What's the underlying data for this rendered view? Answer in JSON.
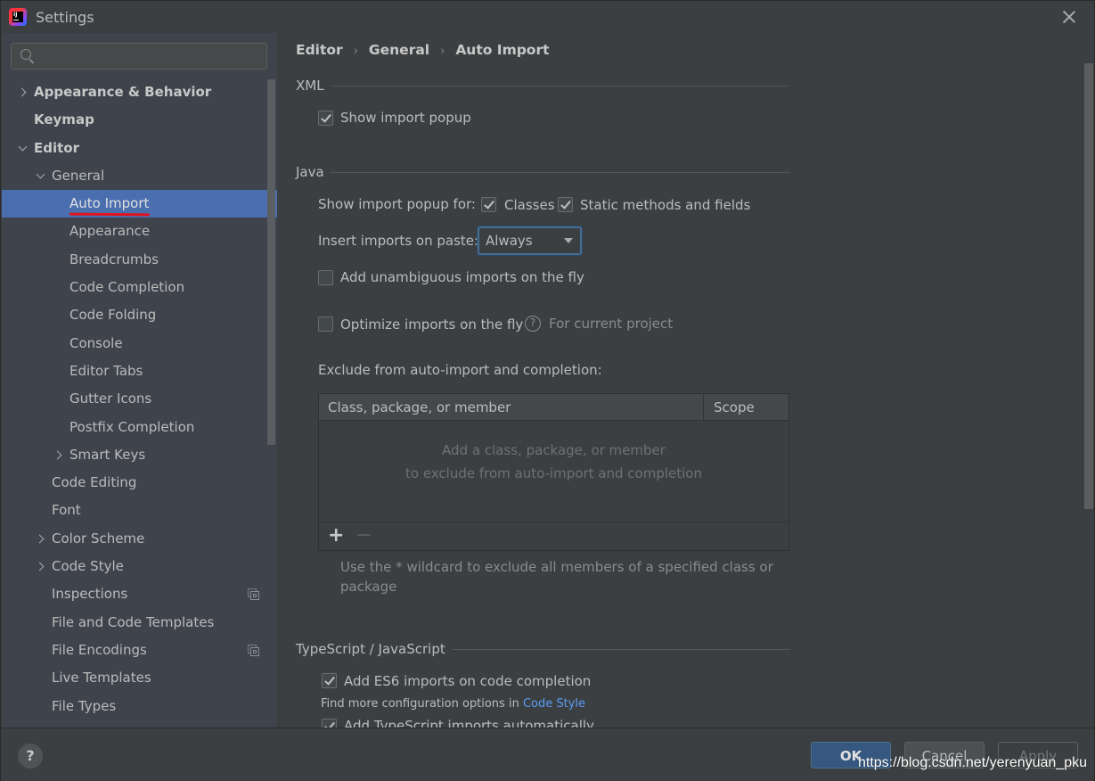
{
  "window": {
    "title": "Settings",
    "app_icon": "intellij-idea-icon",
    "close_icon": "close-icon"
  },
  "sidebar": {
    "search": {
      "placeholder": "",
      "value": ""
    },
    "items": [
      {
        "label": "Appearance & Behavior",
        "level": 0,
        "bold": true,
        "arrow": "right"
      },
      {
        "label": "Keymap",
        "level": 0,
        "bold": true,
        "arrow": ""
      },
      {
        "label": "Editor",
        "level": 0,
        "bold": true,
        "arrow": "down"
      },
      {
        "label": "General",
        "level": 1,
        "bold": false,
        "arrow": "down"
      },
      {
        "label": "Auto Import",
        "level": 2,
        "bold": false,
        "arrow": "",
        "selected": true
      },
      {
        "label": "Appearance",
        "level": 2,
        "bold": false,
        "arrow": ""
      },
      {
        "label": "Breadcrumbs",
        "level": 2,
        "bold": false,
        "arrow": ""
      },
      {
        "label": "Code Completion",
        "level": 2,
        "bold": false,
        "arrow": ""
      },
      {
        "label": "Code Folding",
        "level": 2,
        "bold": false,
        "arrow": ""
      },
      {
        "label": "Console",
        "level": 2,
        "bold": false,
        "arrow": ""
      },
      {
        "label": "Editor Tabs",
        "level": 2,
        "bold": false,
        "arrow": ""
      },
      {
        "label": "Gutter Icons",
        "level": 2,
        "bold": false,
        "arrow": ""
      },
      {
        "label": "Postfix Completion",
        "level": 2,
        "bold": false,
        "arrow": ""
      },
      {
        "label": "Smart Keys",
        "level": 2,
        "bold": false,
        "arrow": "right"
      },
      {
        "label": "Code Editing",
        "level": 1,
        "bold": false,
        "arrow": ""
      },
      {
        "label": "Font",
        "level": 1,
        "bold": false,
        "arrow": ""
      },
      {
        "label": "Color Scheme",
        "level": 1,
        "bold": false,
        "arrow": "right"
      },
      {
        "label": "Code Style",
        "level": 1,
        "bold": false,
        "arrow": "right"
      },
      {
        "label": "Inspections",
        "level": 1,
        "bold": false,
        "arrow": "",
        "project_icon": true
      },
      {
        "label": "File and Code Templates",
        "level": 1,
        "bold": false,
        "arrow": ""
      },
      {
        "label": "File Encodings",
        "level": 1,
        "bold": false,
        "arrow": "",
        "project_icon": true
      },
      {
        "label": "Live Templates",
        "level": 1,
        "bold": false,
        "arrow": ""
      },
      {
        "label": "File Types",
        "level": 1,
        "bold": false,
        "arrow": ""
      }
    ]
  },
  "breadcrumb": [
    "Editor",
    "General",
    "Auto Import"
  ],
  "xml": {
    "title": "XML",
    "show_import_popup": {
      "label": "Show import popup",
      "checked": true
    }
  },
  "java": {
    "title": "Java",
    "show_popup_for_label": "Show import popup for:",
    "classes": {
      "label": "Classes",
      "checked": true
    },
    "static_methods": {
      "label": "Static methods and fields",
      "checked": true
    },
    "insert_on_paste_label": "Insert imports on paste:",
    "insert_on_paste_value": "Always",
    "add_unambiguous": {
      "label": "Add unambiguous imports on the fly",
      "checked": false
    },
    "optimize_imports": {
      "label": "Optimize imports on the fly",
      "checked": false
    },
    "optimize_hint": "For current project",
    "exclude_label": "Exclude from auto-import and completion:",
    "table": {
      "columns": [
        "Class, package, or member",
        "Scope"
      ],
      "rows": [],
      "empty_line1": "Add a class, package, or member",
      "empty_line2": "to exclude from auto-import and completion",
      "add_label": "+",
      "remove_label": "−"
    },
    "wildcard_hint_line1": "Use the * wildcard to exclude all members of a specified class or",
    "wildcard_hint_line2": "package"
  },
  "typescript": {
    "title": "TypeScript / JavaScript",
    "add_es6": {
      "label": "Add ES6 imports on code completion",
      "checked": true
    },
    "more_options_prefix": "Find more configuration options in ",
    "more_options_link": "Code Style",
    "add_ts_auto": {
      "label": "Add TypeScript imports automatically",
      "checked": true
    }
  },
  "footer": {
    "help_label": "?",
    "ok_label": "OK",
    "cancel_label": "Cancel",
    "apply_label": "Apply",
    "watermark": "https://blog.csdn.net/yerenyuan_pku"
  },
  "colors": {
    "selection": "#4b6eaf",
    "link": "#589df6",
    "ok_button": "#365880",
    "annotation_underline": "#e0141e"
  }
}
